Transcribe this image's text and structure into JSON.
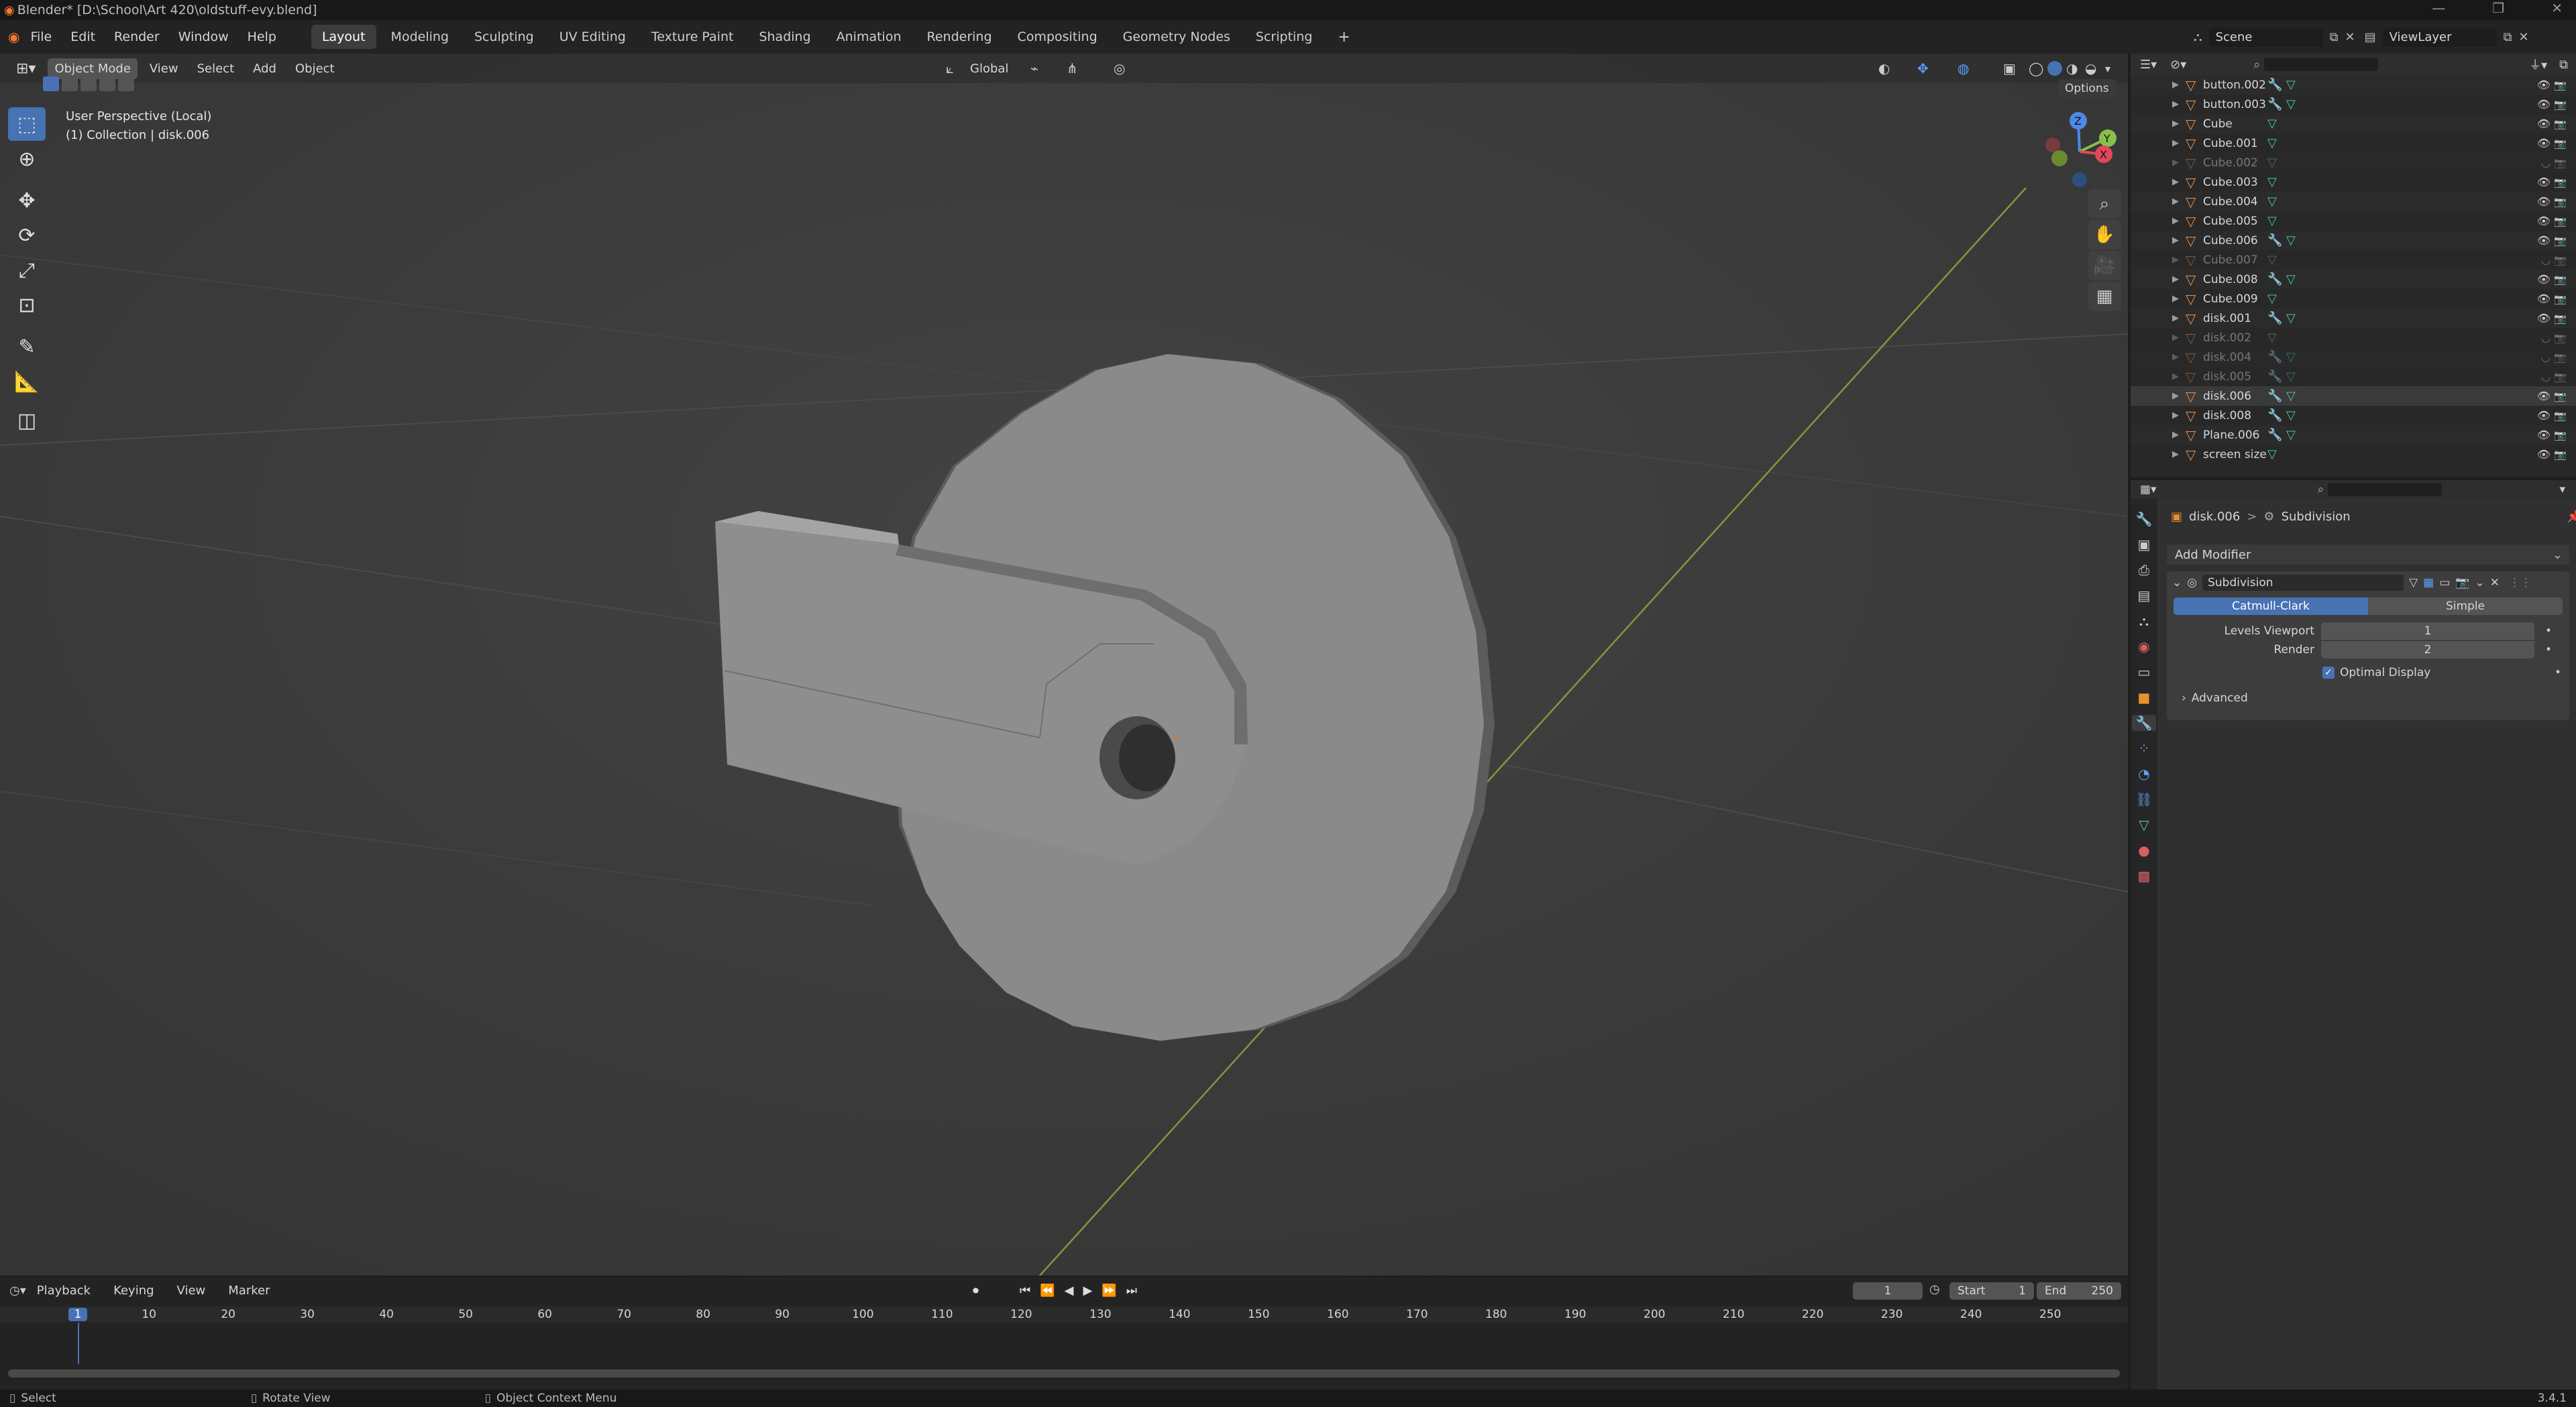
{
  "titlebar": {
    "title": "Blender* [D:\\School\\Art 420\\oldstuff-evy.blend]"
  },
  "topbar": {
    "menus": [
      "File",
      "Edit",
      "Render",
      "Window",
      "Help"
    ],
    "workspaces": [
      "Layout",
      "Modeling",
      "Sculpting",
      "UV Editing",
      "Texture Paint",
      "Shading",
      "Animation",
      "Rendering",
      "Compositing",
      "Geometry Nodes",
      "Scripting"
    ],
    "add": "+",
    "scene": "Scene",
    "view_layer": "ViewLayer"
  },
  "viewport": {
    "mode": "Object Mode",
    "menus": [
      "View",
      "Select",
      "Add",
      "Object"
    ],
    "orientation": "Global",
    "options": "Options",
    "overlay_line1": "User Perspective (Local)",
    "overlay_line2": "(1) Collection | disk.006",
    "gizmo": {
      "z": "Z",
      "y": "Y",
      "x": "X"
    }
  },
  "outliner": {
    "rows": [
      {
        "name": "button.002",
        "mod": true,
        "dim": false
      },
      {
        "name": "button.003",
        "mod": true,
        "dim": false
      },
      {
        "name": "Cube",
        "mod": false,
        "dim": false
      },
      {
        "name": "Cube.001",
        "mod": false,
        "dim": false
      },
      {
        "name": "Cube.002",
        "mod": false,
        "dim": true
      },
      {
        "name": "Cube.003",
        "mod": false,
        "dim": false
      },
      {
        "name": "Cube.004",
        "mod": false,
        "dim": false
      },
      {
        "name": "Cube.005",
        "mod": false,
        "dim": false
      },
      {
        "name": "Cube.006",
        "mod": true,
        "dim": false
      },
      {
        "name": "Cube.007",
        "mod": false,
        "dim": true
      },
      {
        "name": "Cube.008",
        "mod": true,
        "dim": false
      },
      {
        "name": "Cube.009",
        "mod": false,
        "dim": false
      },
      {
        "name": "disk.001",
        "mod": true,
        "dim": false
      },
      {
        "name": "disk.002",
        "mod": false,
        "dim": true
      },
      {
        "name": "disk.004",
        "mod": true,
        "dim": true
      },
      {
        "name": "disk.005",
        "mod": true,
        "dim": true
      },
      {
        "name": "disk.006",
        "mod": true,
        "dim": false
      },
      {
        "name": "disk.008",
        "mod": true,
        "dim": false
      },
      {
        "name": "Plane.006",
        "mod": true,
        "dim": false
      },
      {
        "name": "screen size",
        "mod": false,
        "dim": false
      }
    ]
  },
  "properties": {
    "breadcrumb_object": "disk.006",
    "breadcrumb_sep": ">",
    "breadcrumb_modifier": "Subdivision",
    "add_modifier": "Add Modifier",
    "modifier_name": "Subdivision",
    "tab_catmull": "Catmull-Clark",
    "tab_simple": "Simple",
    "levels_viewport_label": "Levels Viewport",
    "levels_viewport_value": "1",
    "render_label": "Render",
    "render_value": "2",
    "optimal_display": "Optimal Display",
    "advanced": "Advanced"
  },
  "timeline": {
    "menus": [
      "Playback",
      "Keying",
      "View",
      "Marker"
    ],
    "current_frame": "1",
    "start_label": "Start",
    "start_value": "1",
    "end_label": "End",
    "end_value": "250",
    "ticks": [
      "1",
      "10",
      "20",
      "30",
      "40",
      "50",
      "60",
      "70",
      "80",
      "90",
      "100",
      "110",
      "120",
      "130",
      "140",
      "150",
      "160",
      "170",
      "180",
      "190",
      "200",
      "210",
      "220",
      "230",
      "240",
      "250"
    ]
  },
  "status": {
    "select": "Select",
    "rotate": "Rotate View",
    "context": "Object Context Menu",
    "version": "3.4.1"
  }
}
